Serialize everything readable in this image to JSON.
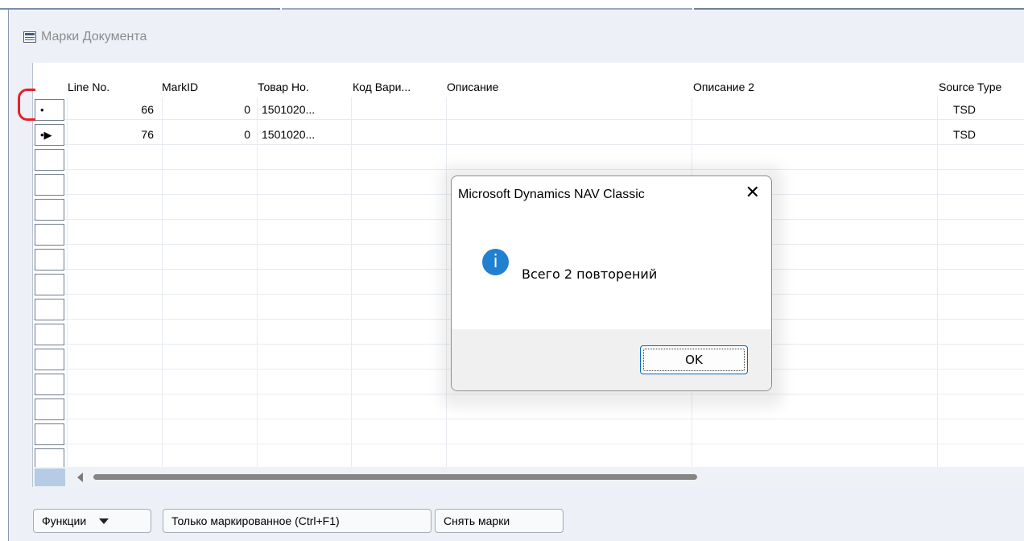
{
  "window": {
    "title": "Марки Документа",
    "icon": "table-form-icon"
  },
  "table": {
    "headers": {
      "line_no": "Line No.",
      "mark_id": "MarkID",
      "item_no": "Товар Но.",
      "variant_code": "Код Вари...",
      "description": "Описание",
      "description2": "Описание 2",
      "source_type": "Source Type"
    },
    "rows": [
      {
        "selector": "•",
        "line_no": "66",
        "mark_id": "0",
        "item_no": "1501020...",
        "variant_code": "",
        "description": "",
        "description2": "",
        "source_type": "TSD"
      },
      {
        "selector": "•▶",
        "line_no": "76",
        "mark_id": "0",
        "item_no": "1501020...",
        "variant_code": "",
        "description": "",
        "description2": "",
        "source_type": "TSD"
      }
    ]
  },
  "buttons": {
    "functions": "Функции",
    "marked_only": "Только маркированное (Ctrl+F1)",
    "clear_marks": "Снять марки"
  },
  "dialog": {
    "title": "Microsoft Dynamics NAV Classic",
    "close": "✕",
    "icon": "info-icon",
    "icon_glyph": "i",
    "message": "Всего 2 повторений",
    "ok": "OK"
  },
  "colors": {
    "accent": "#0067c0",
    "info_icon": "#2280d0",
    "annotation": "#e8202a",
    "window_bg": "#edf1f7"
  }
}
